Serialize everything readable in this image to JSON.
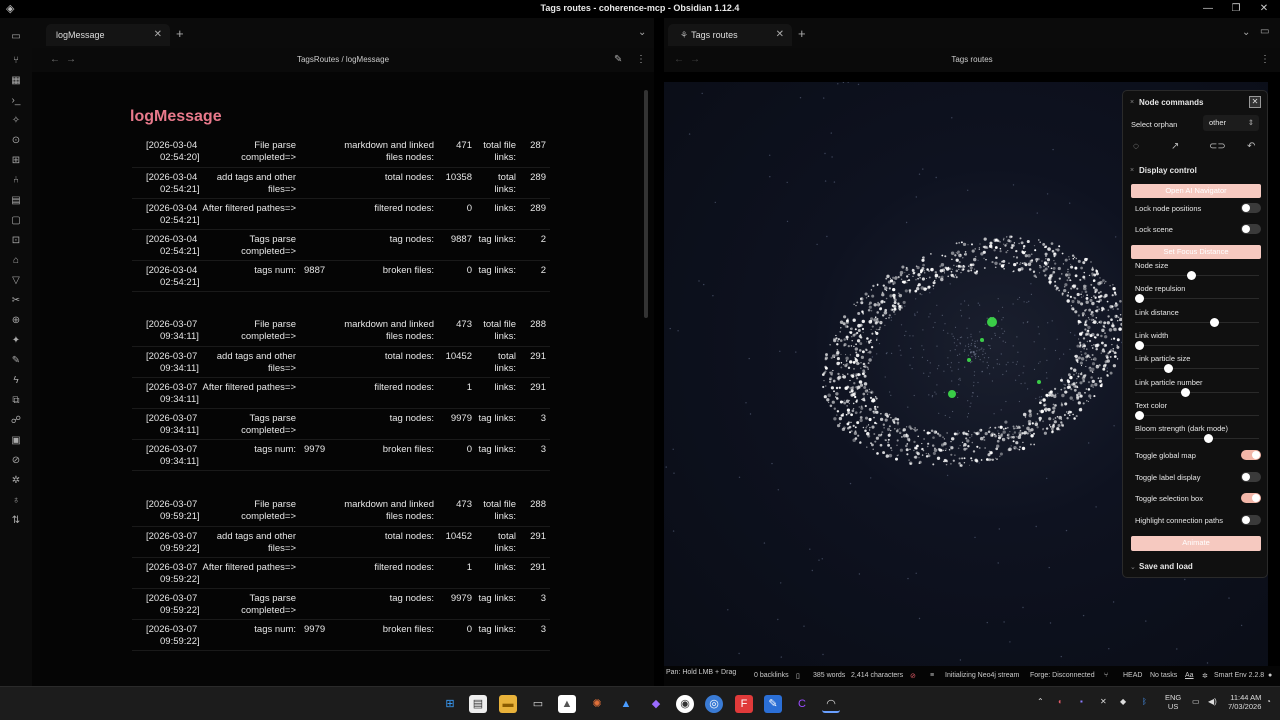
{
  "window": {
    "title": "Tags routes - coherence-mcp - Obsidian 1.12.4"
  },
  "tabs": {
    "left": {
      "label": "logMessage"
    },
    "right": {
      "label": "Tags routes"
    }
  },
  "left_view": {
    "breadcrumb": "TagsRoutes / logMessage"
  },
  "right_view": {
    "title": "Tags routes"
  },
  "document": {
    "title": "logMessage",
    "blocks": [
      {
        "rows": [
          {
            "ts": [
              "[2026-03-04",
              "02:54:20]"
            ],
            "l1": "File parse completed=>",
            "v1": "",
            "l2": "markdown and linked files nodes:",
            "v2": "471",
            "l3": "total file links:",
            "v3": "287"
          },
          {
            "ts": [
              "[2026-03-04",
              "02:54:21]"
            ],
            "l1": "add tags and other files=>",
            "v1": "",
            "l2": "total nodes:",
            "v2": "10358",
            "l3": "total links:",
            "v3": "289"
          },
          {
            "ts": [
              "[2026-03-04",
              "02:54:21]"
            ],
            "l1": "After filtered pathes=>",
            "v1": "",
            "l2": "filtered nodes:",
            "v2": "0",
            "l3": "links:",
            "v3": "289"
          },
          {
            "ts": [
              "[2026-03-04",
              "02:54:21]"
            ],
            "l1": "Tags parse completed=>",
            "v1": "",
            "l2": "tag nodes:",
            "v2": "9887",
            "l3": "tag links:",
            "v3": "2"
          },
          {
            "ts": [
              "[2026-03-04",
              "02:54:21]"
            ],
            "l1": "tags num:",
            "v1": "9887",
            "l2": "broken files:",
            "v2": "0",
            "l3": "tag links:",
            "v3": "2"
          }
        ]
      },
      {
        "rows": [
          {
            "ts": [
              "[2026-03-07",
              "09:34:11]"
            ],
            "l1": "File parse completed=>",
            "v1": "",
            "l2": "markdown and linked files nodes:",
            "v2": "473",
            "l3": "total file links:",
            "v3": "288"
          },
          {
            "ts": [
              "[2026-03-07",
              "09:34:11]"
            ],
            "l1": "add tags and other files=>",
            "v1": "",
            "l2": "total nodes:",
            "v2": "10452",
            "l3": "total links:",
            "v3": "291"
          },
          {
            "ts": [
              "[2026-03-07",
              "09:34:11]"
            ],
            "l1": "After filtered pathes=>",
            "v1": "",
            "l2": "filtered nodes:",
            "v2": "1",
            "l3": "links:",
            "v3": "291"
          },
          {
            "ts": [
              "[2026-03-07",
              "09:34:11]"
            ],
            "l1": "Tags parse completed=>",
            "v1": "",
            "l2": "tag nodes:",
            "v2": "9979",
            "l3": "tag links:",
            "v3": "3"
          },
          {
            "ts": [
              "[2026-03-07",
              "09:34:11]"
            ],
            "l1": "tags num:",
            "v1": "9979",
            "l2": "broken files:",
            "v2": "0",
            "l3": "tag links:",
            "v3": "3"
          }
        ]
      },
      {
        "rows": [
          {
            "ts": [
              "[2026-03-07",
              "09:59:21]"
            ],
            "l1": "File parse completed=>",
            "v1": "",
            "l2": "markdown and linked files nodes:",
            "v2": "473",
            "l3": "total file links:",
            "v3": "288"
          },
          {
            "ts": [
              "[2026-03-07",
              "09:59:22]"
            ],
            "l1": "add tags and other files=>",
            "v1": "",
            "l2": "total nodes:",
            "v2": "10452",
            "l3": "total links:",
            "v3": "291"
          },
          {
            "ts": [
              "[2026-03-07",
              "09:59:22]"
            ],
            "l1": "After filtered pathes=>",
            "v1": "",
            "l2": "filtered nodes:",
            "v2": "1",
            "l3": "links:",
            "v3": "291"
          },
          {
            "ts": [
              "[2026-03-07",
              "09:59:22]"
            ],
            "l1": "Tags parse completed=>",
            "v1": "",
            "l2": "tag nodes:",
            "v2": "9979",
            "l3": "tag links:",
            "v3": "3"
          },
          {
            "ts": [
              "[2026-03-07",
              "09:59:22]"
            ],
            "l1": "tags num:",
            "v1": "9979",
            "l2": "broken files:",
            "v2": "0",
            "l3": "tag links:",
            "v3": "3"
          }
        ]
      }
    ]
  },
  "panel": {
    "node_commands": "Node commands",
    "select_orphan_label": "Select orphan",
    "select_orphan_value": "other",
    "display_control": "Display control",
    "open_navigator": "Open AI Navigator",
    "lock_node_positions": "Lock node positions",
    "lock_node_positions_on": false,
    "lock_scene": "Lock scene",
    "lock_scene_on": false,
    "set_focus_distance": "Set Focus Distance",
    "sliders": [
      {
        "label": "Node size",
        "value": 0.45
      },
      {
        "label": "Node repulsion",
        "value": 0.0
      },
      {
        "label": "Link distance",
        "value": 0.65
      },
      {
        "label": "Link width",
        "value": 0.0
      },
      {
        "label": "Link particle size",
        "value": 0.25
      },
      {
        "label": "Link particle number",
        "value": 0.4
      },
      {
        "label": "Text color",
        "value": 0.0
      },
      {
        "label": "Bloom strength (dark mode)",
        "value": 0.6
      }
    ],
    "toggles": [
      {
        "label": "Toggle global map",
        "on": true
      },
      {
        "label": "Toggle label display",
        "on": false
      },
      {
        "label": "Toggle selection box",
        "on": true
      },
      {
        "label": "Highlight connection paths",
        "on": false
      }
    ],
    "animate": "Animate",
    "save_and_load": "Save and load"
  },
  "statusbar": {
    "hint": "Pan: Hold LMB + Drag",
    "backlinks": "0 backlinks",
    "words": "385 words",
    "characters": "2,414 characters",
    "neo4j": "Initializing Neo4j stream",
    "forge": "Forge: Disconnected",
    "head": "HEAD",
    "tasks": "No tasks",
    "aa": "Aa",
    "smart_env": "Smart Env 2.2.8"
  },
  "taskbar": {
    "lang1": "ENG",
    "lang2": "US",
    "time": "11:44 AM",
    "date": "7/03/2026"
  },
  "colors": {
    "accent": "#e8798b",
    "toggle_on": "#f2b6a8",
    "button_pink": "#f6c9c0"
  }
}
